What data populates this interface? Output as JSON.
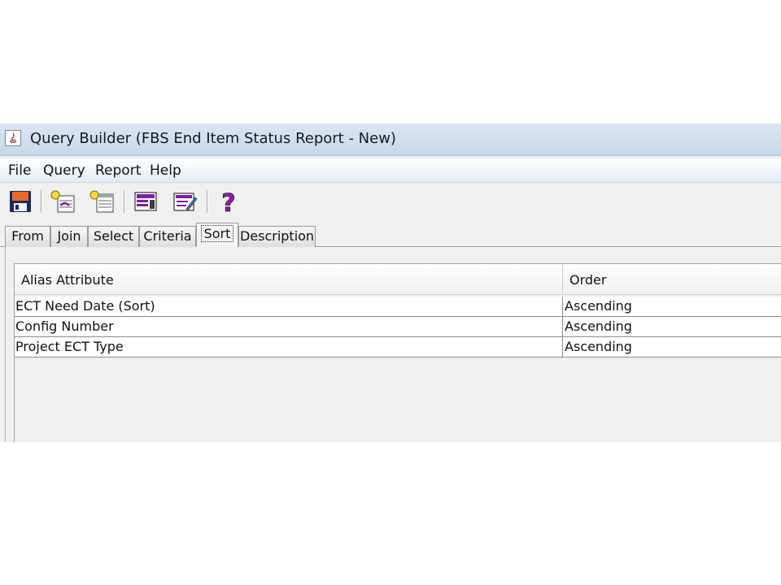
{
  "window": {
    "title": "Query Builder (FBS End Item Status Report - New)"
  },
  "menu": {
    "items": [
      "File",
      "Query",
      "Report",
      "Help"
    ]
  },
  "toolbar": {
    "buttons": [
      "save-icon",
      "add-join-icon",
      "add-select-icon",
      "criteria-icon",
      "edit-icon",
      "help-icon"
    ]
  },
  "tabs": {
    "items": [
      "From",
      "Join",
      "Select",
      "Criteria",
      "Sort",
      "Description"
    ],
    "active": "Sort"
  },
  "sort_table": {
    "columns": [
      "Alias Attribute",
      "Order"
    ],
    "rows": [
      [
        "ECT Need Date (Sort)",
        "Ascending"
      ],
      [
        "Config Number",
        "Ascending"
      ],
      [
        "Project ECT Type",
        "Ascending"
      ]
    ]
  },
  "colors": {
    "titlebar": "#c9d8ea",
    "window_bg": "#f0f0f0",
    "help_icon": "#8b1fa8"
  }
}
